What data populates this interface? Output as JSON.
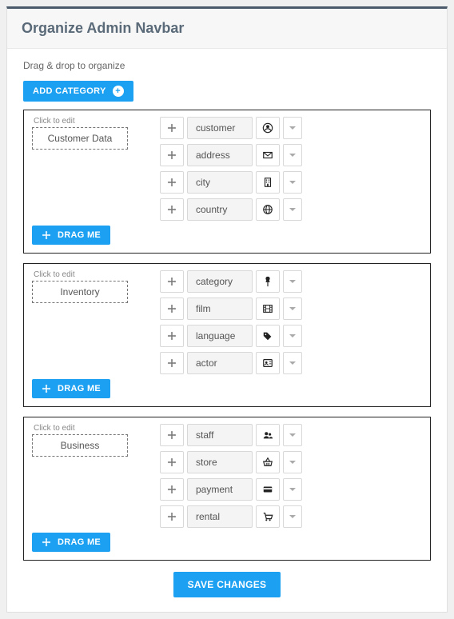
{
  "header": {
    "title": "Organize Admin Navbar"
  },
  "hint": "Drag & drop to organize",
  "add_category_label": "ADD CATEGORY",
  "drag_me_label": "DRAG ME",
  "click_to_edit_label": "Click to edit",
  "save_label": "SAVE CHANGES",
  "categories": [
    {
      "name": "Customer Data",
      "items": [
        {
          "label": "customer",
          "icon": "user-circle"
        },
        {
          "label": "address",
          "icon": "envelope"
        },
        {
          "label": "city",
          "icon": "building"
        },
        {
          "label": "country",
          "icon": "globe"
        }
      ]
    },
    {
      "name": "Inventory",
      "items": [
        {
          "label": "category",
          "icon": "pin"
        },
        {
          "label": "film",
          "icon": "film"
        },
        {
          "label": "language",
          "icon": "tags"
        },
        {
          "label": "actor",
          "icon": "id-card"
        }
      ]
    },
    {
      "name": "Business",
      "items": [
        {
          "label": "staff",
          "icon": "users"
        },
        {
          "label": "store",
          "icon": "basket"
        },
        {
          "label": "payment",
          "icon": "credit-card"
        },
        {
          "label": "rental",
          "icon": "cart"
        }
      ]
    }
  ]
}
